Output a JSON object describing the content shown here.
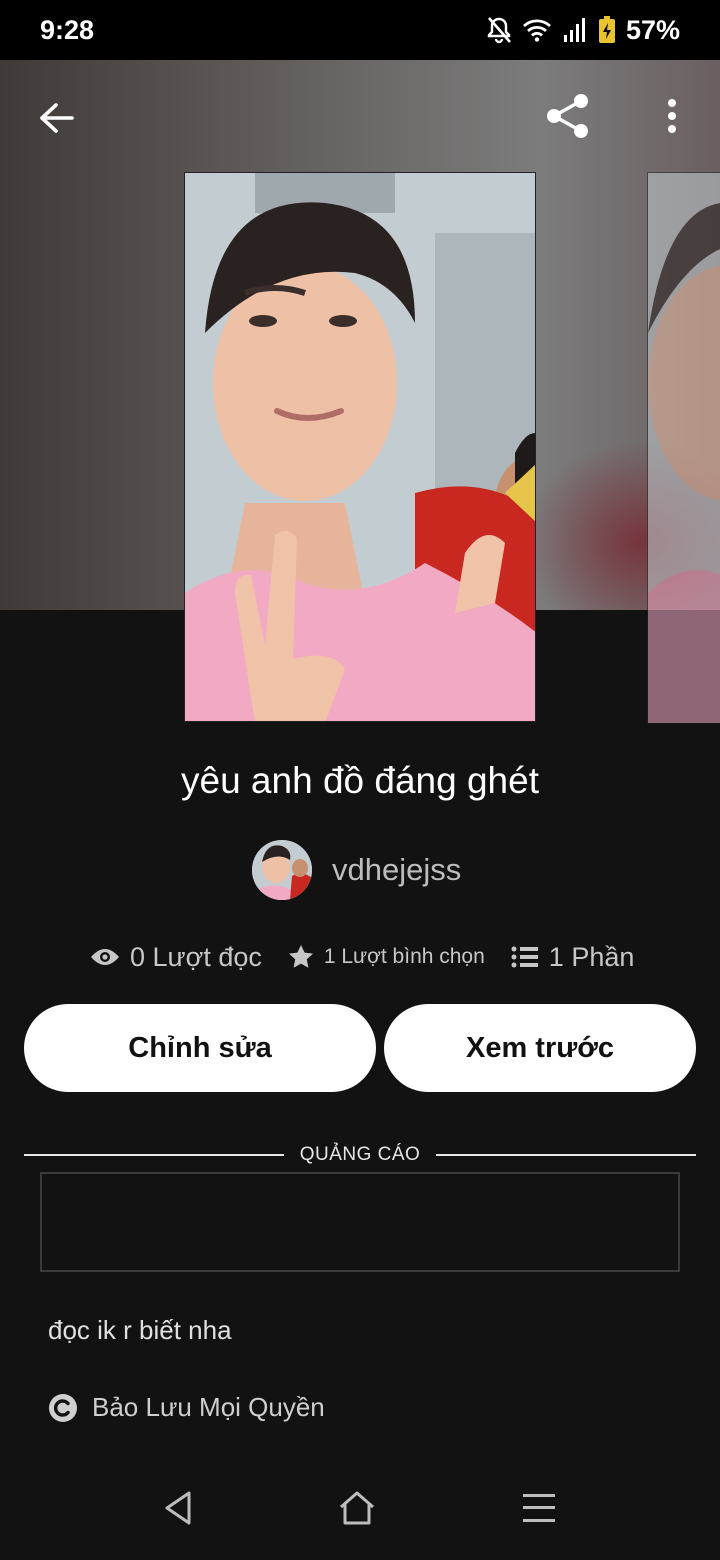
{
  "status_bar": {
    "time": "9:28",
    "battery": "57%",
    "icons": [
      "bell-off-icon",
      "wifi-icon",
      "signal-icon",
      "battery-charging-icon"
    ]
  },
  "toolbar": {
    "back_icon": "arrow-left-icon",
    "share_icon": "share-icon",
    "more_icon": "more-vertical-icon"
  },
  "story": {
    "title": "yêu anh đồ đáng ghét",
    "author": "vdhejejss",
    "reads": "0 Lượt đọc",
    "votes": "1 Lượt bình chọn",
    "parts": "1 Phần",
    "description": "đọc ik r biết nha",
    "copyright": "Bảo Lưu Mọi Quyền"
  },
  "actions": {
    "edit_label": "Chỉnh sửa",
    "preview_label": "Xem trước"
  },
  "ad": {
    "label": "QUẢNG CÁO"
  },
  "nav_bar": {
    "icons": [
      "back-triangle-icon",
      "home-icon",
      "recents-menu-icon"
    ]
  },
  "colors": {
    "background": "#121212",
    "button_bg": "#ffffff",
    "muted_text": "#bdbdbd"
  }
}
